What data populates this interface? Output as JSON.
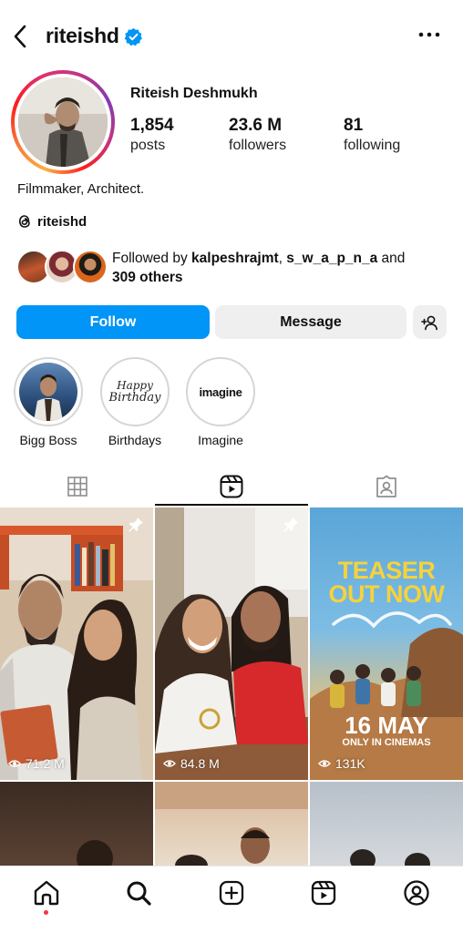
{
  "header": {
    "username": "riteishd"
  },
  "profile": {
    "full_name": "Riteish Deshmukh",
    "stats": [
      {
        "value": "1,854",
        "label": "posts"
      },
      {
        "value": "23.6 M",
        "label": "followers"
      },
      {
        "value": "81",
        "label": "following"
      }
    ],
    "bio": "Filmmaker, Architect.",
    "threads_handle": "riteishd"
  },
  "followed_by": {
    "prefix": "Followed by ",
    "user1": "kalpeshrajmt",
    "separator": ", ",
    "user2": "s_w_a_p_n_a",
    "and": " and",
    "others": "309 others"
  },
  "actions": {
    "follow_label": "Follow",
    "message_label": "Message"
  },
  "highlights": [
    {
      "label": "Bigg Boss"
    },
    {
      "label": "Birthdays",
      "art_line1": "Happy",
      "art_line2": "Birthday"
    },
    {
      "label": "Imagine",
      "art_text": "imagine"
    }
  ],
  "tabs": [
    "grid",
    "reels",
    "tagged"
  ],
  "reels": [
    {
      "views": "71.2 M",
      "pinned": true
    },
    {
      "views": "84.8 M",
      "pinned": true
    },
    {
      "views": "131K",
      "pinned": false,
      "poster_title_1": "TEASER",
      "poster_title_2": "OUT NOW",
      "poster_date": "16 MAY",
      "poster_sub": "ONLY IN CINEMAS"
    }
  ],
  "colors": {
    "accent": "#0095f6",
    "verified": "#0095f6",
    "notification_dot": "#ff3040"
  },
  "bottom_nav": [
    "home-icon",
    "search-icon",
    "create-icon",
    "reels-icon",
    "profile-icon"
  ]
}
